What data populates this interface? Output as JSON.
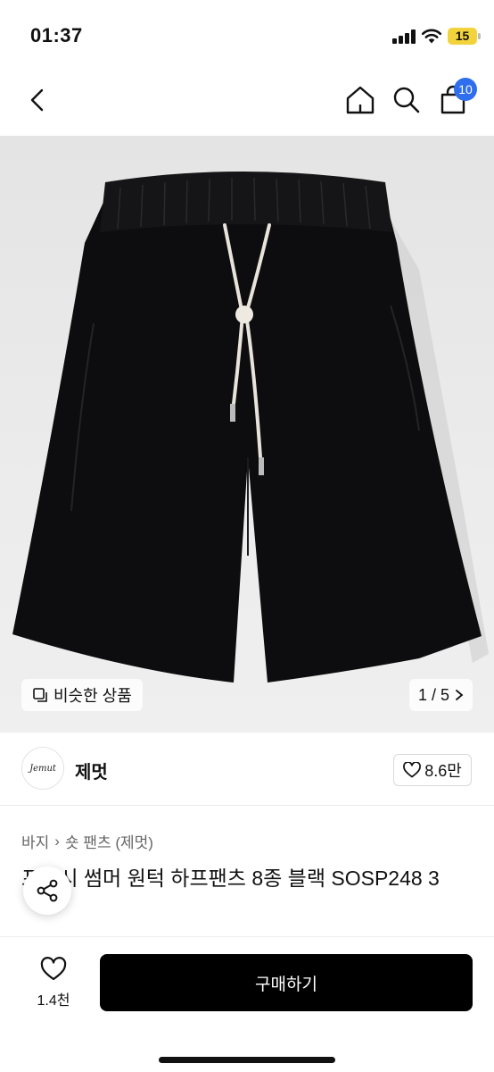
{
  "status_bar": {
    "time": "01:37",
    "battery": "15"
  },
  "nav": {
    "cart_badge": "10"
  },
  "hero": {
    "similar_label": "비슷한 상품",
    "pager": "1 / 5"
  },
  "brand": {
    "logo_text": "Jemut",
    "name": "제멋",
    "likes": "8.6만"
  },
  "breadcrumb": {
    "level1": "바지",
    "separator": "›",
    "level2": "숏 팬츠 (제멋)"
  },
  "product": {
    "title": "프리시 썸머 원턱 하프팬츠 8종 블랙 SOSP248 3"
  },
  "bottom": {
    "wish_count": "1.4천",
    "buy_label": "구매하기"
  },
  "colors": {
    "badge": "#2f6fed",
    "battery": "#f2d33b",
    "buy_button": "#000000"
  }
}
